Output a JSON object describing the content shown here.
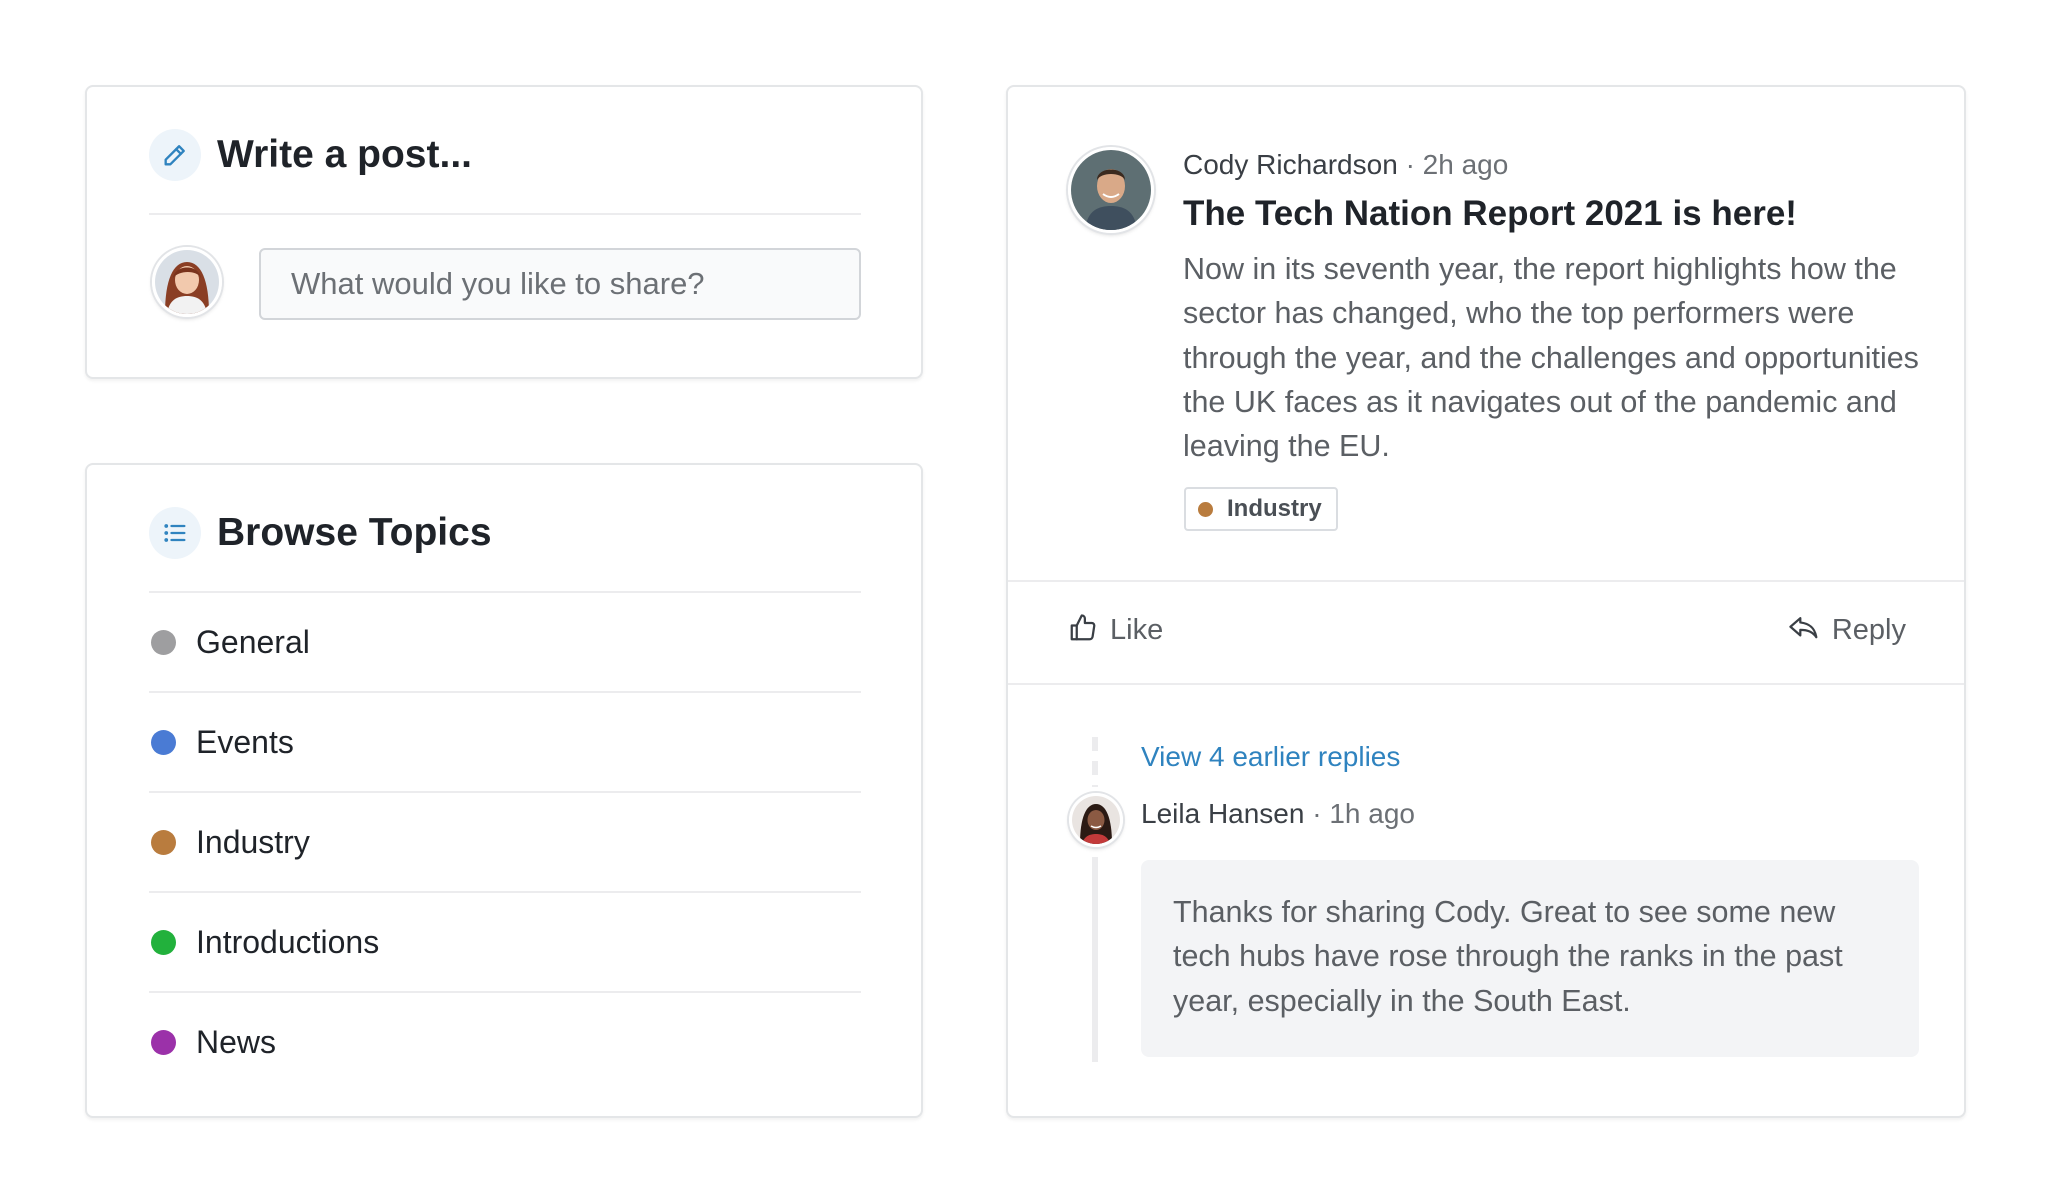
{
  "composer": {
    "title": "Write a post...",
    "placeholder": "What would you like to share?"
  },
  "topics": {
    "title": "Browse Topics",
    "items": [
      {
        "label": "General",
        "color": "#9e9ea0"
      },
      {
        "label": "Events",
        "color": "#4a7bd4"
      },
      {
        "label": "Industry",
        "color": "#b97c3e"
      },
      {
        "label": "Introductions",
        "color": "#22b13c"
      },
      {
        "label": "News",
        "color": "#9b31a9"
      }
    ]
  },
  "post": {
    "author": "Cody Richardson",
    "separator": "·",
    "time": "2h ago",
    "title": "The Tech Nation Report 2021 is here!",
    "body": "Now in its seventh year, the report highlights how the sector has changed, who the top performers were through the year, and the challenges and opportunities the UK faces as it navigates out of the pandemic and leaving the EU.",
    "tag": {
      "label": "Industry",
      "color": "#b97c3e"
    },
    "actions": {
      "like": "Like",
      "reply": "Reply"
    }
  },
  "thread": {
    "earlier_replies": "View 4 earlier replies",
    "reply": {
      "author": "Leila Hansen",
      "separator": "·",
      "time": "1h ago",
      "body": "Thanks for sharing Cody. Great to see some new tech hubs have rose through the ranks in the past year, especially in the South East."
    }
  },
  "colors": {
    "accent": "#2f83bf",
    "icon_bg": "#edf4fa",
    "divider": "#ececee"
  }
}
